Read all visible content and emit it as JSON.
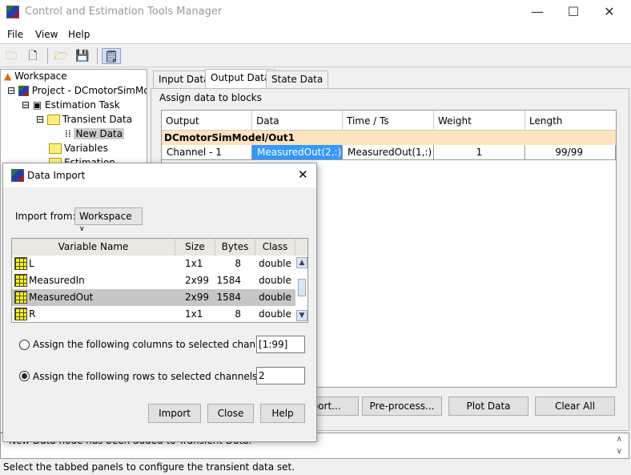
{
  "window": {
    "title": "Control and Estimation Tools Manager",
    "minimize": "—",
    "maximize": "☐",
    "close": "✕"
  },
  "menu": [
    "File",
    "View",
    "Help"
  ],
  "toolbar": {
    "icons": [
      "new-project-icon",
      "new-task-icon",
      "open-icon",
      "save-icon",
      "notes-icon"
    ]
  },
  "tree": {
    "items": [
      "Workspace",
      "Project - DCmotorSimModel",
      "Estimation Task",
      "Transient Data",
      "New Data",
      "Variables",
      "Estimation"
    ]
  },
  "tabs": [
    "Input Data",
    "Output Data",
    "State Data"
  ],
  "panel": {
    "section_label": "Assign data to blocks",
    "columns": [
      "Output",
      "Data",
      "Time / Ts",
      "Weight",
      "Length"
    ],
    "group": "DCmotorSimModel/Out1",
    "row": [
      "Channel - 1",
      "MeasuredOut(2,:)",
      "MeasuredOut(1,:)",
      "1",
      "99/99"
    ],
    "buttons": [
      "Import...",
      "Pre-process...",
      "Plot Data",
      "Clear All"
    ]
  },
  "message": "New Data node has been added to Transient Data.",
  "status": "Select the tabbed panels to configure the transient data set.",
  "dialog": {
    "title": "Data Import",
    "close": "✕",
    "import_from_label": "Import from:",
    "import_from_value": "Workspace",
    "columns": [
      "Variable Name",
      "Size",
      "Bytes",
      "Class"
    ],
    "rows": [
      [
        "L",
        "1x1",
        "8",
        "double"
      ],
      [
        "MeasuredIn",
        "2x99",
        "1584",
        "double"
      ],
      [
        "MeasuredOut",
        "2x99",
        "1584",
        "double"
      ],
      [
        "R",
        "1x1",
        "8",
        "double"
      ]
    ],
    "selected_row": "MeasuredOut",
    "columns_option": {
      "label": "Assign the following columns to selected channels:",
      "value": "[1:99]",
      "selected": false
    },
    "rows_option": {
      "label": "Assign the following rows to selected channels:",
      "value": "2",
      "selected": true
    },
    "buttons": [
      "Import",
      "Close",
      "Help"
    ]
  },
  "colors": {
    "selection": "#3399ff",
    "group_row": "#fce4bf",
    "selected_var": "#c6c6c6"
  }
}
